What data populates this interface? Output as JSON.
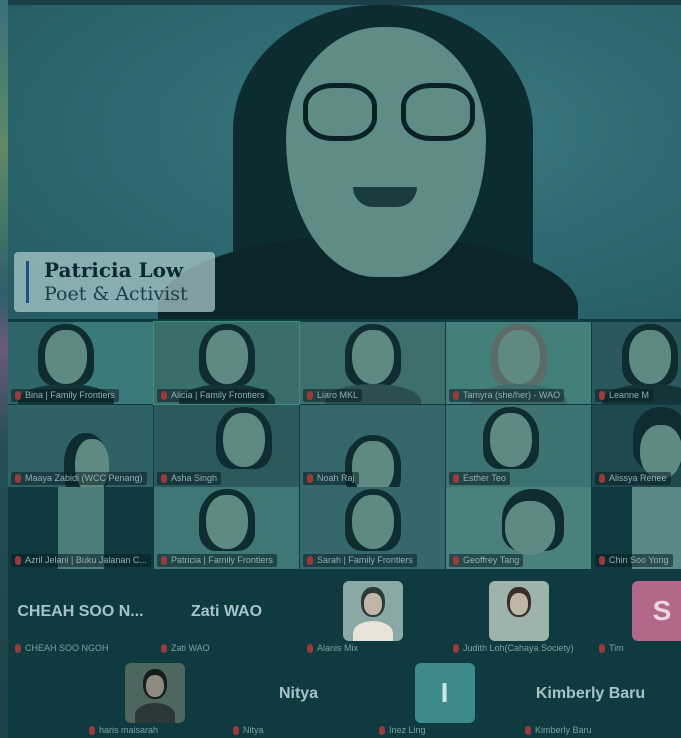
{
  "speaker": {
    "name": "Patricia Low",
    "role": "Poet & Activist"
  },
  "gallery": {
    "row1": [
      {
        "label": "Bina | Family Frontiers"
      },
      {
        "label": "Alicia | Family Frontiers"
      },
      {
        "label": "Liaro MKL"
      },
      {
        "label": "Tamyra (she/her) - WAO"
      },
      {
        "label": "Leanne M"
      }
    ],
    "row2": [
      {
        "label": "Maaya Zabidi (WCC Penang)"
      },
      {
        "label": "Asha Singh"
      },
      {
        "label": "Noah Raj"
      },
      {
        "label": "Esther Teo"
      },
      {
        "label": "Alissya Renee"
      }
    ],
    "row3": [
      {
        "label": "Azril Jelani | Buku Jalanan C..."
      },
      {
        "label": "Patricia | Family Frontiers"
      },
      {
        "label": "Sarah | Family Frontiers"
      },
      {
        "label": "Geoffrey Tang"
      },
      {
        "label": "Chin Soo Yong"
      }
    ],
    "row4": [
      {
        "display": "CHEAH SOO N...",
        "label": "CHEAH SOO NGOH"
      },
      {
        "display": "Zati WAO",
        "label": "Zati WAO"
      },
      {
        "label": "Alanis Mix"
      },
      {
        "label": "Judith Loh(Cahaya Society)"
      },
      {
        "initial": "S",
        "label": "Tim"
      }
    ],
    "row5": [
      {
        "label": "haris maisarah"
      },
      {
        "display": "Nitya",
        "label": "Nitya"
      },
      {
        "initial": "I",
        "label": "Inez Ling"
      },
      {
        "display": "Kimberly Baru",
        "label": "Kimberly Baru"
      }
    ]
  },
  "colors": {
    "overlay": "#0f3a40",
    "muted_mic": "#9a3b3b",
    "lower_third_accent": "#1d4f8c"
  }
}
